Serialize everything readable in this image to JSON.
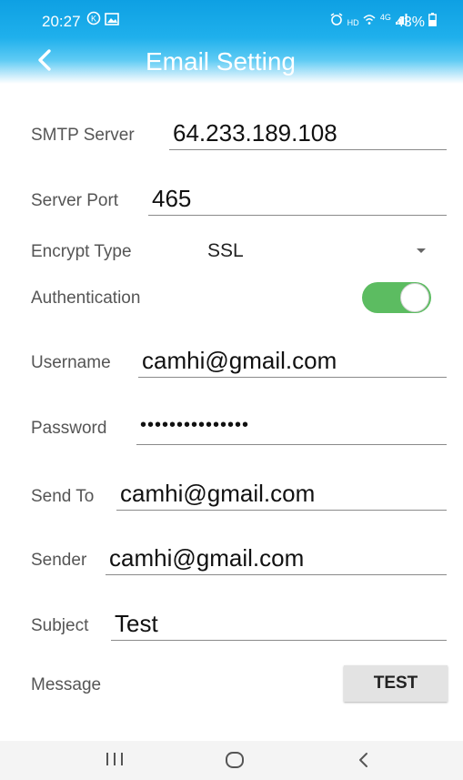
{
  "status_bar": {
    "time": "20:27",
    "network": "4G",
    "battery": "43%",
    "icons": [
      "notification-icon",
      "image-icon",
      "alarm-icon",
      "hd-icon",
      "wifi-icon",
      "signal-icon",
      "battery-icon"
    ]
  },
  "header": {
    "title": "Email Setting",
    "back_icon": "chevron-left-icon",
    "gradient_color": "#0ea0e3"
  },
  "form": {
    "smtp_server": {
      "label": "SMTP Server",
      "value": "64.233.189.108"
    },
    "server_port": {
      "label": "Server Port",
      "value": "465"
    },
    "encrypt_type": {
      "label": "Encrypt Type",
      "value": "SSL"
    },
    "authentication": {
      "label": "Authentication",
      "enabled": true,
      "color": "#5cbc61"
    },
    "username": {
      "label": "Username",
      "value": "camhi@gmail.com"
    },
    "password": {
      "label": "Password",
      "value": "•••••••••••••••"
    },
    "send_to": {
      "label": "Send To",
      "value": "camhi@gmail.com"
    },
    "sender": {
      "label": "Sender",
      "value": "camhi@gmail.com"
    },
    "subject": {
      "label": "Subject",
      "value": "Test"
    },
    "message": {
      "label": "Message"
    }
  },
  "buttons": {
    "test_label": "TEST"
  },
  "nav_bar": {
    "recent_icon": "recent-apps-icon",
    "home_icon": "home-icon",
    "back_icon": "back-icon"
  }
}
